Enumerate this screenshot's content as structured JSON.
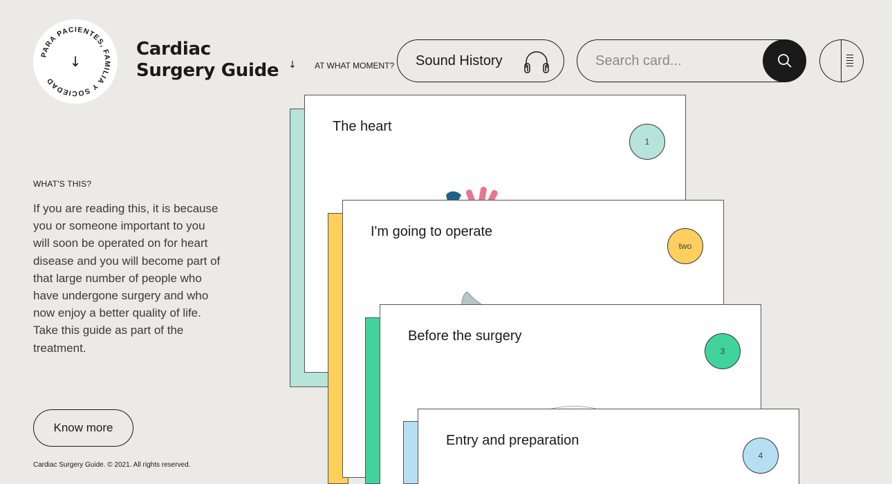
{
  "header": {
    "seal_text": "PARA PACIENTES, FAMILIA Y SOCIEDAD",
    "seal_arrow": "↓",
    "title_line1": "Cardiac",
    "title_line2": "Surgery Guide",
    "title_arrow": "↓",
    "moment_label": "AT WHAT MOMENT?",
    "sound_history_label": "Sound History",
    "search_placeholder": "Search card..."
  },
  "sidebar": {
    "whats_this_label": "WHAT'S THIS?",
    "intro_text": "If you are reading this, it is because you or someone important to you will soon be operated on for heart disease and you will become part of that large number of people who have undergone surgery and who now enjoy a better quality of life. Take this guide as part of the treatment.",
    "know_more_label": "Know more",
    "footer": "Cardiac Surgery Guide. © 2021. All rights reserved."
  },
  "cards": [
    {
      "title": "The heart",
      "number": "1",
      "color": "#b6e3da"
    },
    {
      "title": "I'm going to operate",
      "number": "two",
      "color": "#fdcf5c"
    },
    {
      "title": "Before the surgery",
      "number": "3",
      "color": "#40d49c"
    },
    {
      "title": "Entry and preparation",
      "number": "4",
      "color": "#b6dff4"
    }
  ],
  "colors": {
    "background": "#ebeae6",
    "dark": "#1a1a1a"
  },
  "icons": {
    "sound": "headphones-icon",
    "search": "search-icon",
    "menu": "menu-icon"
  }
}
